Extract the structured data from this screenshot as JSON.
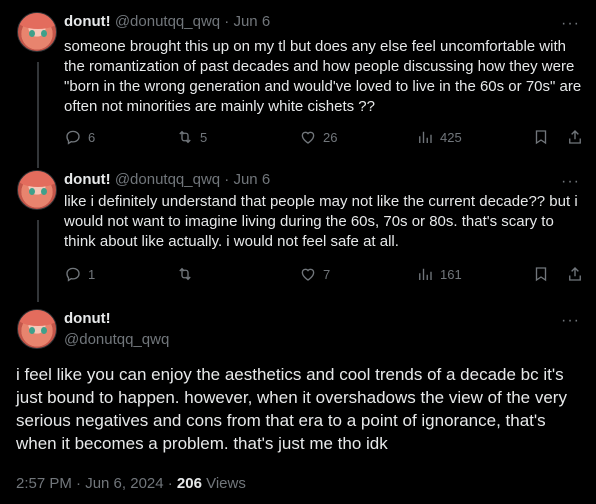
{
  "tweets": [
    {
      "name": "donut!",
      "handle": "@donutqq_qwq",
      "sep": "·",
      "date": "Jun 6",
      "more": "···",
      "text": "someone brought this up on my tl but does any else feel uncomfortable with the romantization of past decades and how people discussing how they were \"born in the wrong generation and would've loved to live in the 60s or 70s\" are often not minorities are mainly white cishets ??",
      "replies": "6",
      "reposts": "5",
      "likes": "26",
      "views": "425"
    },
    {
      "name": "donut!",
      "handle": "@donutqq_qwq",
      "sep": "·",
      "date": "Jun 6",
      "more": "···",
      "text": "like i definitely understand that people may not like the current decade?? but i would not want to imagine living during the 60s, 70s or 80s. that's scary to think about like actually. i would not feel safe at all.",
      "replies": "1",
      "reposts": "",
      "likes": "7",
      "views": "161"
    }
  ],
  "main": {
    "name": "donut!",
    "handle": "@donutqq_qwq",
    "more": "···",
    "text": "i feel like you can enjoy the aesthetics and cool trends of a decade bc it's just bound to happen. however, when it overshadows the view of the very serious negatives and cons from that era to a point of ignorance, that's when it becomes a problem. that's just me tho idk",
    "time": "2:57 PM · Jun 6, 2024 · ",
    "views_count": "206",
    "views_label": " Views"
  },
  "colors": {
    "background": "#000000",
    "text": "#e7e9ea",
    "muted": "#71767b",
    "line": "#333639"
  },
  "icons": [
    "reply-icon",
    "repost-icon",
    "like-icon",
    "views-icon",
    "bookmark-icon",
    "share-icon",
    "more-icon"
  ]
}
